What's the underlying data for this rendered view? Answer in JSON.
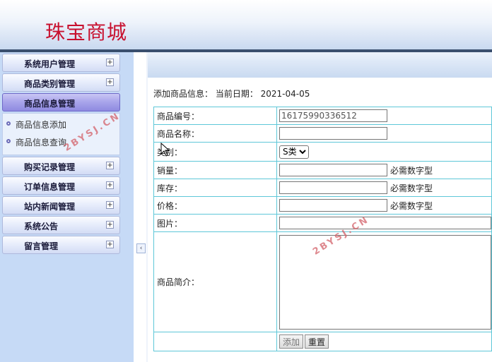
{
  "header": {
    "brand": "珠宝商城"
  },
  "sidebar": {
    "menus": [
      {
        "label": "系统用户管理"
      },
      {
        "label": "商品类别管理"
      },
      {
        "label": "商品信息管理",
        "active": true,
        "submenu": [
          "商品信息添加",
          "商品信息查询"
        ]
      },
      {
        "label": "购买记录管理"
      },
      {
        "label": "订单信息管理"
      },
      {
        "label": "站内新闻管理"
      },
      {
        "label": "系统公告"
      },
      {
        "label": "留言管理"
      }
    ],
    "collapse_glyph": "‹"
  },
  "main": {
    "page_info": "添加商品信息： 当前日期： 2021-04-05",
    "form": {
      "code_label": "商品编号：",
      "code_value": "16175990336512",
      "name_label": "商品名称：",
      "category_label": "类别：",
      "category_selected": "S类",
      "sales_label": "销量：",
      "sales_hint": "必需数字型",
      "stock_label": "库存：",
      "stock_hint": "必需数字型",
      "price_label": "价格：",
      "price_hint": "必需数字型",
      "image_label": "图片：",
      "intro_label": "商品简介：",
      "add_button": "添加",
      "reset_button": "重置"
    }
  },
  "watermark": "2BYSJ.CN",
  "colors": {
    "brand": "#c8102e",
    "table_border": "#5ec7d8",
    "watermark": "#d4626a"
  }
}
